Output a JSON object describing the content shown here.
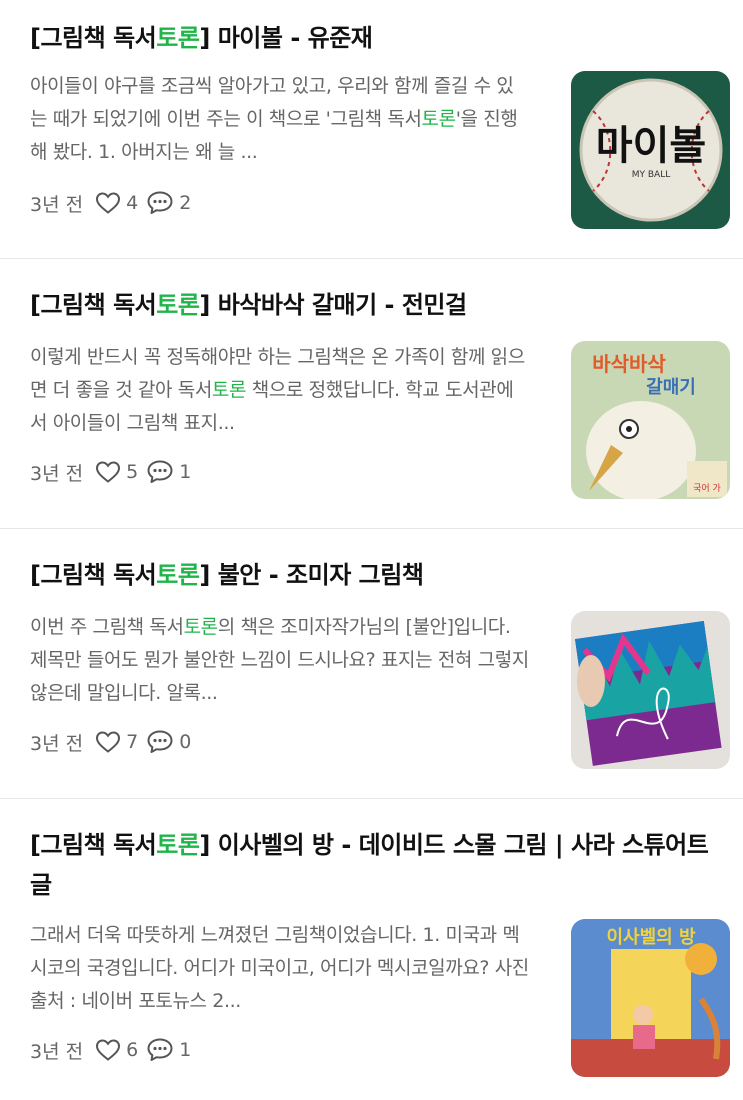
{
  "posts": [
    {
      "title": {
        "prefix": "[그림책 독서",
        "highlight": "토론",
        "suffix": "] 마이볼 - 유준재"
      },
      "excerpt": {
        "before": "아이들이 야구를 조금씩 알아가고 있고, 우리와 함께 즐길 수 있는 때가 되었기에 이번 주는 이 책으로 '그림책 독서",
        "highlight": "토론",
        "after": "'을 진행해 봤다. 1. 아버지는 왜 늘 ..."
      },
      "age": "3년 전",
      "likes": "4",
      "comments": "2",
      "thumbnail": {
        "label": "마이볼",
        "sub": "MY BALL",
        "icon": "baseball-book-cover"
      }
    },
    {
      "title": {
        "prefix": "[그림책 독서",
        "highlight": "토론",
        "suffix": "] 바삭바삭 갈매기 - 전민걸"
      },
      "excerpt": {
        "before": "이렇게 반드시 꼭 정독해야만 하는 그림책은 온 가족이 함께 읽으면 더 좋을 것 같아 독서",
        "highlight": "토론",
        "after": " 책으로 정했답니다. 학교 도서관에서 아이들이 그림책 표지..."
      },
      "age": "3년 전",
      "likes": "5",
      "comments": "1",
      "thumbnail": {
        "label": "바삭바삭",
        "label2": "갈매기",
        "badge": "국어 가",
        "icon": "seagull-book-cover"
      }
    },
    {
      "title": {
        "prefix": "[그림책 독서",
        "highlight": "토론",
        "suffix": "] 불안 - 조미자 그림책"
      },
      "excerpt": {
        "before": "이번 주 그림책 독서",
        "highlight": "토론",
        "after": "의 책은 조미자작가님의 [불안]입니다. 제목만 들어도 뭔가 불안한 느낌이 드시나요? 표지는 전혀 그렇지 않은데 말입니다. 알록..."
      },
      "age": "3년 전",
      "likes": "7",
      "comments": "0",
      "thumbnail": {
        "icon": "anxiety-book-cover"
      }
    },
    {
      "title": {
        "prefix": "[그림책 독서",
        "highlight": "토론",
        "suffix": "] 이사벨의 방 - 데이비드 스몰 그림 | 사라 스튜어트 글"
      },
      "excerpt": {
        "before": "그래서 더욱 따뜻하게 느껴졌던 그림책이었습니다. 1. 미국과 멕시코의 국경입니다. 어디가 미국이고, 어디가 멕시코일까요? 사진출처 : 네이버 포토뉴스 2...",
        "highlight": "",
        "after": ""
      },
      "age": "3년 전",
      "likes": "6",
      "comments": "1",
      "thumbnail": {
        "label": "이사벨의 방",
        "icon": "isabel-room-book-cover"
      }
    }
  ],
  "colors": {
    "highlight": "#1fb548",
    "title": "#111111",
    "meta": "#666666",
    "divider": "#e6e6e6"
  }
}
